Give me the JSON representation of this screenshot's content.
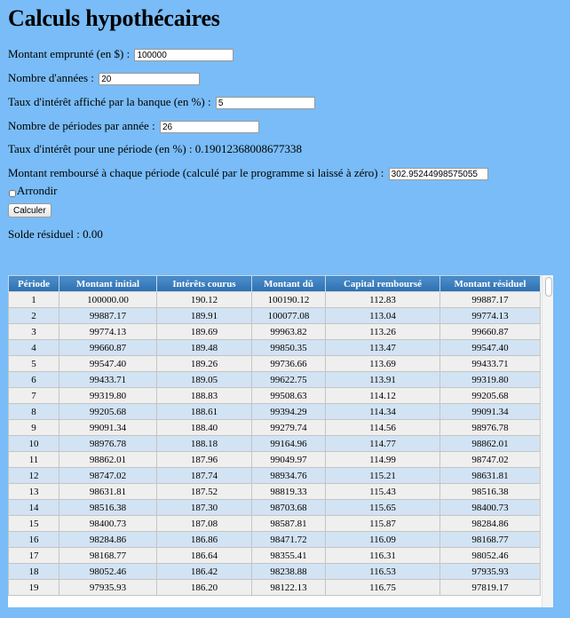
{
  "page": {
    "title": "Calculs hypothécaires"
  },
  "form": {
    "montant_label": "Montant emprunté (en $) :",
    "montant_value": "100000",
    "annees_label": "Nombre d'années :",
    "annees_value": "20",
    "taux_label": "Taux d'intérêt affiché par la banque (en %) :",
    "taux_value": "5",
    "periodes_label": "Nombre de périodes par année :",
    "periodes_value": "26",
    "taux_periode_text": "Taux d'intérêt pour une période (en %) : 0.19012368008677338",
    "rembourse_label": "Montant remboursé à chaque période (calculé par le programme si laissé à zéro) :",
    "rembourse_value": "302.95244998575055",
    "arrondir_label": "Arrondir",
    "calculer_label": "Calculer",
    "solde_text": "Solde résiduel : 0.00"
  },
  "table": {
    "headers": [
      "Période",
      "Montant initial",
      "Intérêts courus",
      "Montant dû",
      "Capital remboursé",
      "Montant résiduel"
    ],
    "rows": [
      [
        "1",
        "100000.00",
        "190.12",
        "100190.12",
        "112.83",
        "99887.17"
      ],
      [
        "2",
        "99887.17",
        "189.91",
        "100077.08",
        "113.04",
        "99774.13"
      ],
      [
        "3",
        "99774.13",
        "189.69",
        "99963.82",
        "113.26",
        "99660.87"
      ],
      [
        "4",
        "99660.87",
        "189.48",
        "99850.35",
        "113.47",
        "99547.40"
      ],
      [
        "5",
        "99547.40",
        "189.26",
        "99736.66",
        "113.69",
        "99433.71"
      ],
      [
        "6",
        "99433.71",
        "189.05",
        "99622.75",
        "113.91",
        "99319.80"
      ],
      [
        "7",
        "99319.80",
        "188.83",
        "99508.63",
        "114.12",
        "99205.68"
      ],
      [
        "8",
        "99205.68",
        "188.61",
        "99394.29",
        "114.34",
        "99091.34"
      ],
      [
        "9",
        "99091.34",
        "188.40",
        "99279.74",
        "114.56",
        "98976.78"
      ],
      [
        "10",
        "98976.78",
        "188.18",
        "99164.96",
        "114.77",
        "98862.01"
      ],
      [
        "11",
        "98862.01",
        "187.96",
        "99049.97",
        "114.99",
        "98747.02"
      ],
      [
        "12",
        "98747.02",
        "187.74",
        "98934.76",
        "115.21",
        "98631.81"
      ],
      [
        "13",
        "98631.81",
        "187.52",
        "98819.33",
        "115.43",
        "98516.38"
      ],
      [
        "14",
        "98516.38",
        "187.30",
        "98703.68",
        "115.65",
        "98400.73"
      ],
      [
        "15",
        "98400.73",
        "187.08",
        "98587.81",
        "115.87",
        "98284.86"
      ],
      [
        "16",
        "98284.86",
        "186.86",
        "98471.72",
        "116.09",
        "98168.77"
      ],
      [
        "17",
        "98168.77",
        "186.64",
        "98355.41",
        "116.31",
        "98052.46"
      ],
      [
        "18",
        "98052.46",
        "186.42",
        "98238.88",
        "116.53",
        "97935.93"
      ],
      [
        "19",
        "97935.93",
        "186.20",
        "98122.13",
        "116.75",
        "97819.17"
      ]
    ]
  }
}
